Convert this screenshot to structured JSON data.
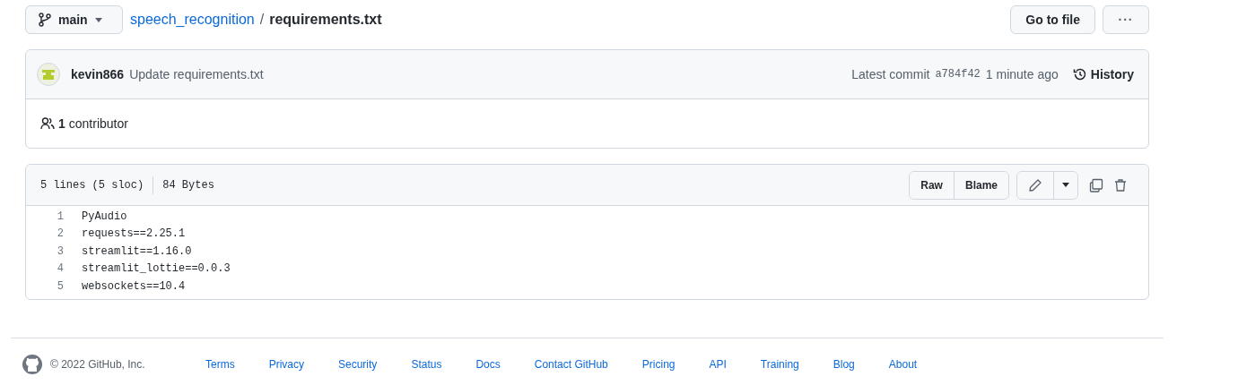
{
  "branch": {
    "name": "main"
  },
  "breadcrumb": {
    "repo": "speech_recognition",
    "separator": "/",
    "file": "requirements.txt"
  },
  "actions": {
    "go_to_file": "Go to file",
    "more": "···"
  },
  "commit": {
    "author": "kevin866",
    "message": "Update requirements.txt",
    "label": "Latest commit",
    "sha": "a784f42",
    "time": "1 minute ago",
    "history": "History"
  },
  "contributors": {
    "count": "1",
    "label": "contributor"
  },
  "file": {
    "lines_info": "5 lines (5 sloc)",
    "size": "84 Bytes",
    "raw": "Raw",
    "blame": "Blame",
    "lines": [
      {
        "number": "1",
        "text": "PyAudio"
      },
      {
        "number": "2",
        "text": "requests==2.25.1"
      },
      {
        "number": "3",
        "text": "streamlit==1.16.0"
      },
      {
        "number": "4",
        "text": "streamlit_lottie==0.0.3"
      },
      {
        "number": "5",
        "text": "websockets==10.4"
      }
    ]
  },
  "footer": {
    "copyright": "© 2022 GitHub, Inc.",
    "links": [
      "Terms",
      "Privacy",
      "Security",
      "Status",
      "Docs",
      "Contact GitHub",
      "Pricing",
      "API",
      "Training",
      "Blog",
      "About"
    ]
  }
}
